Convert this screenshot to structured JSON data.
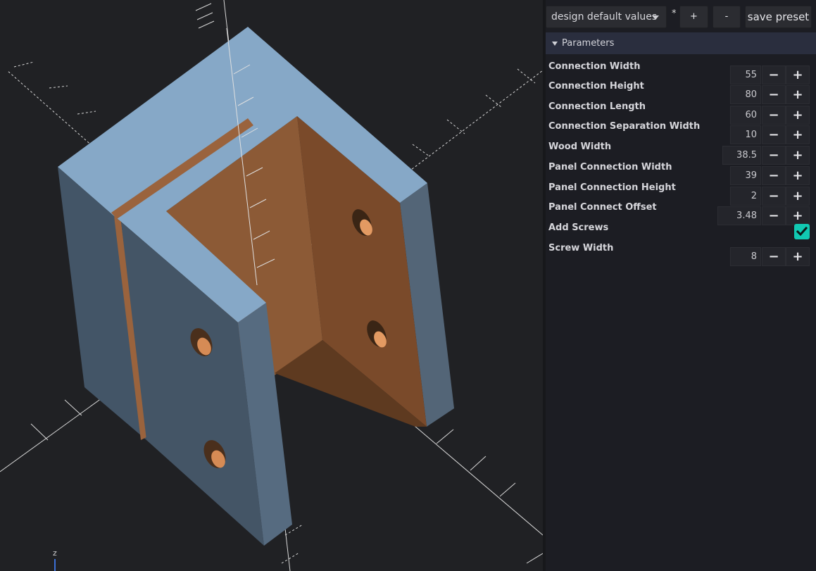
{
  "viewport": {
    "axis_label": "z",
    "colors": {
      "background": "#202124",
      "light_face": "#86a8c7",
      "dark_face": "#445566",
      "wood": "#8b5a35",
      "wood_light": "#c8814b"
    }
  },
  "preset_bar": {
    "selected_preset": "design default values",
    "modified_marker": "*",
    "add_label": "+",
    "remove_label": "-",
    "save_label": "save preset"
  },
  "parameters": {
    "header": "Parameters",
    "items": [
      {
        "label": "Connection Width",
        "value": "55",
        "type": "number"
      },
      {
        "label": "Connection Height",
        "value": "80",
        "type": "number"
      },
      {
        "label": "Connection Length",
        "value": "60",
        "type": "number"
      },
      {
        "label": "Connection Separation Width",
        "value": "10",
        "type": "number"
      },
      {
        "label": "Wood Width",
        "value": "38.5",
        "type": "number"
      },
      {
        "label": "Panel Connection Width",
        "value": "39",
        "type": "number"
      },
      {
        "label": "Panel Connection Height",
        "value": "2",
        "type": "number"
      },
      {
        "label": "Panel Connect Offset",
        "value": "3.48",
        "type": "number"
      },
      {
        "label": "Add Screws",
        "value": true,
        "type": "checkbox"
      },
      {
        "label": "Screw Width",
        "value": "8",
        "type": "number"
      }
    ],
    "decrement_symbol": "−",
    "increment_symbol": "+",
    "accent_color": "#11c9b2"
  }
}
